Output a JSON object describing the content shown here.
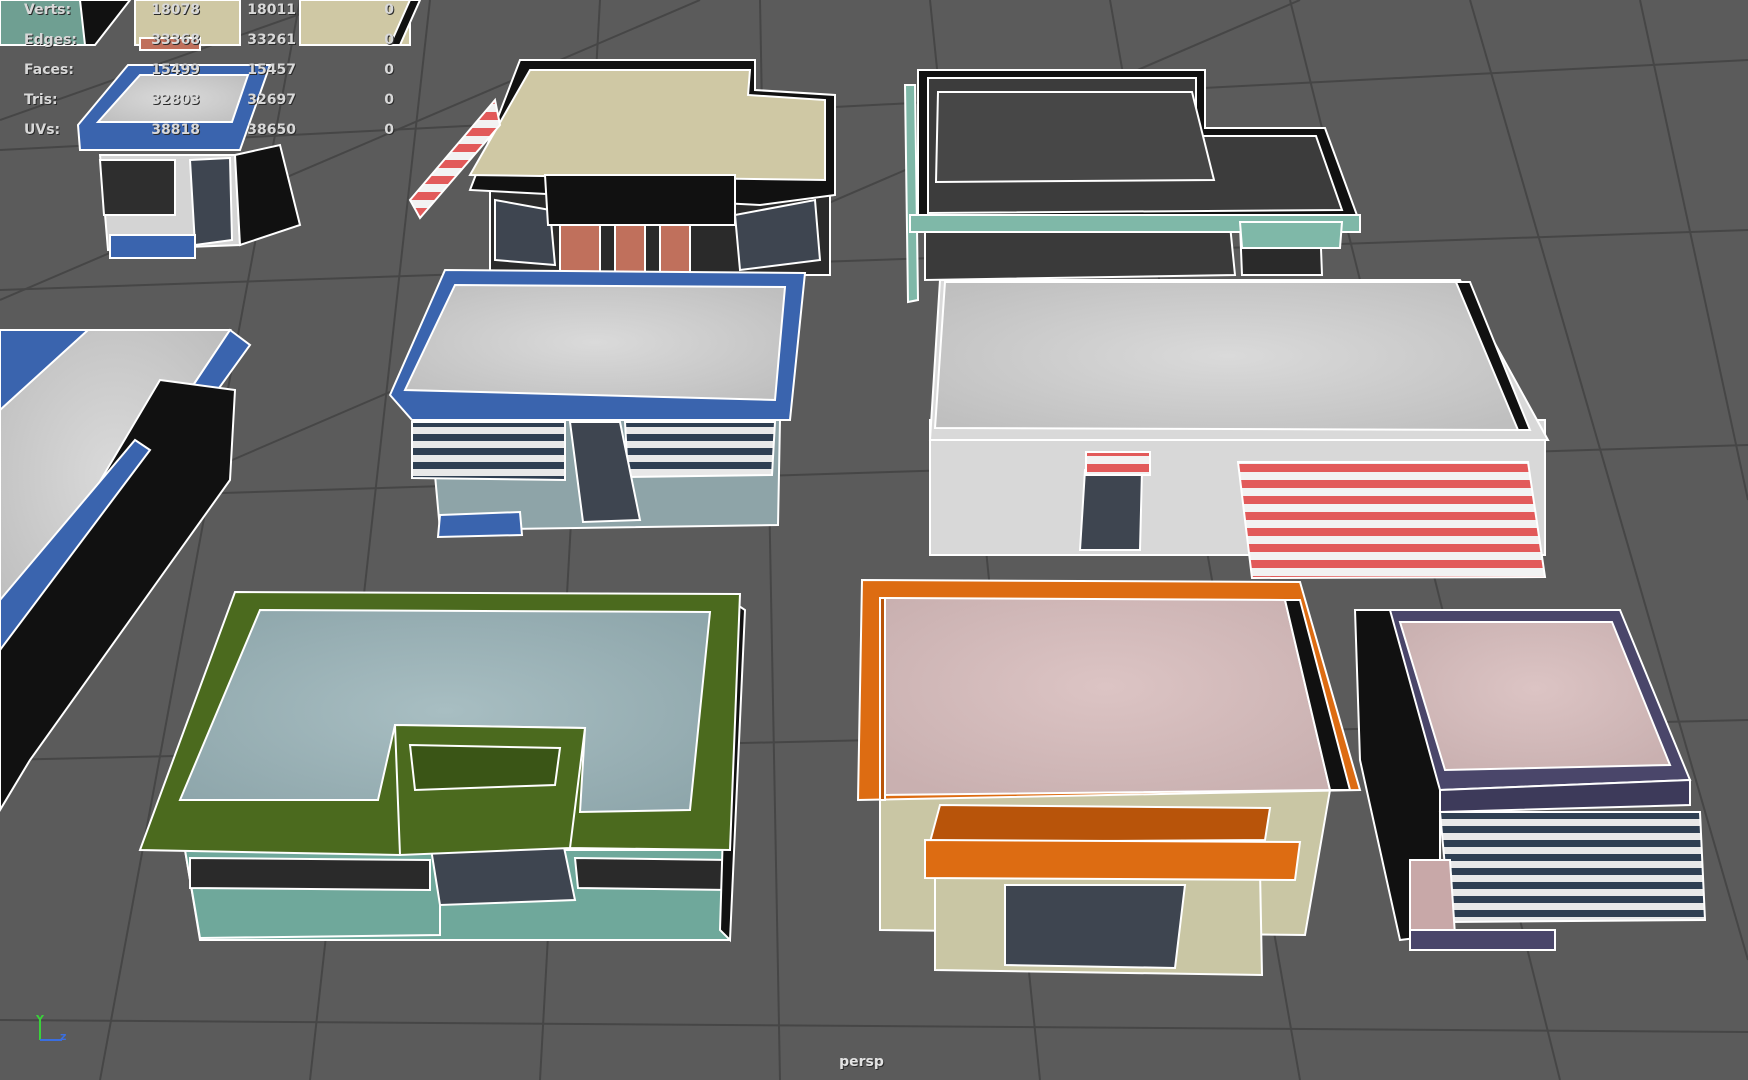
{
  "viewport": {
    "camera_name": "persp",
    "background_color": "#5b5b5b",
    "grid_color": "#454545",
    "wire_color": "#ffffff"
  },
  "hud": {
    "rows": [
      {
        "label": "Verts:",
        "v1": "18078",
        "v2": "18011",
        "v3": "0"
      },
      {
        "label": "Edges:",
        "v1": "33368",
        "v2": "33261",
        "v3": "0"
      },
      {
        "label": "Faces:",
        "v1": "15499",
        "v2": "15457",
        "v3": "0"
      },
      {
        "label": "Tris:",
        "v1": "32803",
        "v2": "32697",
        "v3": "0"
      },
      {
        "label": "UVs:",
        "v1": "38818",
        "v2": "38650",
        "v3": "0"
      }
    ]
  },
  "axis_gizmo": {
    "y_label": "Y",
    "z_label": "z",
    "y_color": "#3ad13a",
    "z_color": "#3a6ee0"
  },
  "buildings": [
    {
      "name": "small-blue-kiosk",
      "trim_color": "#3b64b0",
      "roof_color": "#d6d6d6"
    },
    {
      "name": "beige-shop-red-awning",
      "trim_color": "#1b1b1b",
      "roof_color": "#cfc8a4",
      "awning_color": "#e06060"
    },
    {
      "name": "teal-dark-roof-building",
      "trim_color": "#7fb8a8",
      "roof_color": "#3c3c3c"
    },
    {
      "name": "blue-trim-shop",
      "trim_color": "#3a64ae",
      "roof_color": "#d4d4d4"
    },
    {
      "name": "large-white-store",
      "trim_color": "#dcdcdc",
      "roof_color": "#d2d2d2",
      "awning_color": "#e25a5a"
    },
    {
      "name": "long-blue-building",
      "trim_color": "#3a64ae",
      "roof_color": "#d4d4d4"
    },
    {
      "name": "green-u-building",
      "trim_color": "#4b6a1e",
      "roof_color": "#9db4b8",
      "wall_color": "#6fa89b"
    },
    {
      "name": "orange-pink-store",
      "trim_color": "#dd6c12",
      "roof_color": "#d8bcbc",
      "wall_color": "#c9c6a4"
    },
    {
      "name": "purple-striped-shop",
      "trim_color": "#4a466a",
      "roof_color": "#d8c0c0"
    }
  ]
}
